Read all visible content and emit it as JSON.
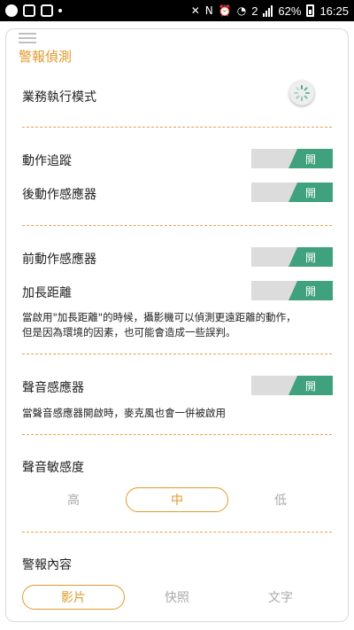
{
  "status_bar": {
    "battery_percent": "62%",
    "time": "16:25",
    "notification_count": "2"
  },
  "screen": {
    "title": "警報偵測",
    "business_mode": {
      "label": "業務執行模式"
    },
    "motion_tracking": {
      "label": "動作追蹤",
      "state": "開"
    },
    "rear_motion_sensor": {
      "label": "後動作感應器",
      "state": "開"
    },
    "front_motion_sensor": {
      "label": "前動作感應器",
      "state": "開"
    },
    "extend_distance": {
      "label": "加長距離",
      "state": "開",
      "description_line1": "當啟用\"加長距離\"的時候，攝影機可以偵測更遠距離的動作，",
      "description_line2": "但是因為環境的因素，也可能會造成一些誤判。"
    },
    "sound_sensor": {
      "label": "聲音感應器",
      "state": "開",
      "description": "當聲音感應器開啟時，麥克風也會一併被啟用"
    },
    "sound_sensitivity": {
      "label": "聲音敏感度",
      "options": [
        "高",
        "中",
        "低"
      ],
      "selected": "中"
    },
    "alert_content": {
      "label": "警報內容",
      "options": [
        "影片",
        "快照",
        "文字"
      ],
      "selected": "影片"
    }
  },
  "colors": {
    "accent": "#e19a2a",
    "toggle_on": "#3fa17e",
    "toggle_off": "#dcdcdc"
  }
}
